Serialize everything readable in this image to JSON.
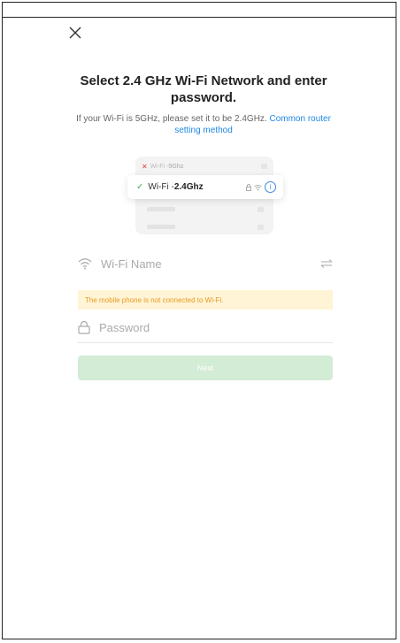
{
  "header": {
    "title": "Select 2.4 GHz Wi-Fi Network and enter password.",
    "subtitle": "If your Wi-Fi is 5GHz, please set it to be 2.4GHz.",
    "link": "Common router setting method"
  },
  "illustration": {
    "row_5g": {
      "prefix": "Wi-Fi - ",
      "band": "5Ghz",
      "status": "unsupported"
    },
    "row_24g": {
      "prefix": "Wi-Fi - ",
      "band": "2.4Ghz",
      "status": "supported"
    }
  },
  "form": {
    "wifi_placeholder": "Wi-Fi Name",
    "warning": "The mobile phone is not connected to Wi-Fi.",
    "password_placeholder": "Password",
    "next_label": "Next"
  },
  "colors": {
    "accent": "#1e88e5",
    "warning_bg": "#fff4d6",
    "warning_text": "#e89a1e",
    "next_bg": "#d3ecd5"
  },
  "icons": {
    "close": "close-icon",
    "wifi": "wifi-icon",
    "lock": "lock-icon",
    "swap": "swap-icon",
    "info": "info-icon"
  }
}
